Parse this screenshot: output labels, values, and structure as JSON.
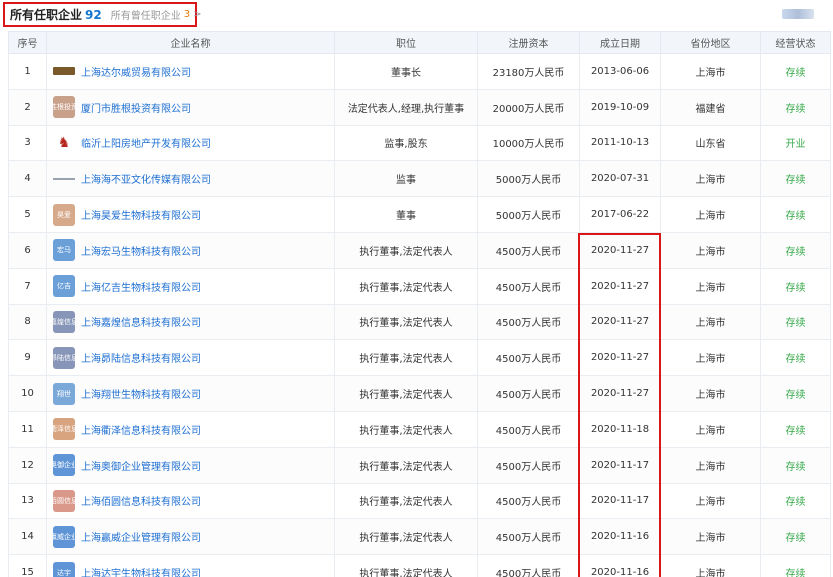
{
  "tabs": {
    "active_label": "所有任职企业",
    "active_count": "92",
    "other_label": "所有曾任职企业",
    "other_count": "3",
    "chevron": ">"
  },
  "table": {
    "headers": [
      "序号",
      "企业名称",
      "职位",
      "注册资本",
      "成立日期",
      "省份地区",
      "经营状态"
    ],
    "rows": [
      {
        "no": "1",
        "logo": "",
        "logo_style": "bar",
        "logo_color": "#7a5a2a",
        "name": "上海达尔威贸易有限公司",
        "position": "董事长",
        "capital": "23180万人民币",
        "date": "2013-06-06",
        "region": "上海市",
        "status": "存续"
      },
      {
        "no": "2",
        "logo": "胜根投资",
        "logo_style": "box",
        "logo_color": "#c9a08a",
        "name": "厦门市胜根投资有限公司",
        "position": "法定代表人,经理,执行董事",
        "capital": "20000万人民币",
        "date": "2019-10-09",
        "region": "福建省",
        "status": "存续"
      },
      {
        "no": "3",
        "logo": "♞",
        "logo_style": "emblem",
        "logo_color": "#ffffff",
        "name": "临沂上阳房地产开发有限公司",
        "position": "监事,股东",
        "capital": "10000万人民币",
        "date": "2011-10-13",
        "region": "山东省",
        "status": "开业"
      },
      {
        "no": "4",
        "logo": "",
        "logo_style": "line",
        "logo_color": "#9aa4b0",
        "name": "上海海不亚文化传媒有限公司",
        "position": "监事",
        "capital": "5000万人民币",
        "date": "2020-07-31",
        "region": "上海市",
        "status": "存续"
      },
      {
        "no": "5",
        "logo": "昊爱",
        "logo_style": "box",
        "logo_color": "#d5a98a",
        "name": "上海昊爱生物科技有限公司",
        "position": "董事",
        "capital": "5000万人民币",
        "date": "2017-06-22",
        "region": "上海市",
        "status": "存续"
      },
      {
        "no": "6",
        "logo": "宏马",
        "logo_style": "box",
        "logo_color": "#6a9fd8",
        "name": "上海宏马生物科技有限公司",
        "position": "执行董事,法定代表人",
        "capital": "4500万人民币",
        "date": "2020-11-27",
        "region": "上海市",
        "status": "存续"
      },
      {
        "no": "7",
        "logo": "亿吉",
        "logo_style": "box",
        "logo_color": "#6a9fd8",
        "name": "上海亿吉生物科技有限公司",
        "position": "执行董事,法定代表人",
        "capital": "4500万人民币",
        "date": "2020-11-27",
        "region": "上海市",
        "status": "存续"
      },
      {
        "no": "8",
        "logo": "嘉煌信息",
        "logo_style": "box",
        "logo_color": "#8796b8",
        "name": "上海嘉煌信息科技有限公司",
        "position": "执行董事,法定代表人",
        "capital": "4500万人民币",
        "date": "2020-11-27",
        "region": "上海市",
        "status": "存续"
      },
      {
        "no": "9",
        "logo": "昴陆信息",
        "logo_style": "box",
        "logo_color": "#8796b8",
        "name": "上海昴陆信息科技有限公司",
        "position": "执行董事,法定代表人",
        "capital": "4500万人民币",
        "date": "2020-11-27",
        "region": "上海市",
        "status": "存续"
      },
      {
        "no": "10",
        "logo": "翔世",
        "logo_style": "box",
        "logo_color": "#7aa8d9",
        "name": "上海翔世生物科技有限公司",
        "position": "执行董事,法定代表人",
        "capital": "4500万人民币",
        "date": "2020-11-27",
        "region": "上海市",
        "status": "存续"
      },
      {
        "no": "11",
        "logo": "衢泽信息",
        "logo_style": "box",
        "logo_color": "#d8a37f",
        "name": "上海衢泽信息科技有限公司",
        "position": "执行董事,法定代表人",
        "capital": "4500万人民币",
        "date": "2020-11-18",
        "region": "上海市",
        "status": "存续"
      },
      {
        "no": "12",
        "logo": "奥御企业",
        "logo_style": "box",
        "logo_color": "#5f95d6",
        "name": "上海奥御企业管理有限公司",
        "position": "执行董事,法定代表人",
        "capital": "4500万人民币",
        "date": "2020-11-17",
        "region": "上海市",
        "status": "存续"
      },
      {
        "no": "13",
        "logo": "佰圆信息",
        "logo_style": "box",
        "logo_color": "#d9988a",
        "name": "上海佰圆信息科技有限公司",
        "position": "执行董事,法定代表人",
        "capital": "4500万人民币",
        "date": "2020-11-17",
        "region": "上海市",
        "status": "存续"
      },
      {
        "no": "14",
        "logo": "赢威企业",
        "logo_style": "box",
        "logo_color": "#5f95d6",
        "name": "上海赢威企业管理有限公司",
        "position": "执行董事,法定代表人",
        "capital": "4500万人民币",
        "date": "2020-11-16",
        "region": "上海市",
        "status": "存续"
      },
      {
        "no": "15",
        "logo": "达宇",
        "logo_style": "box",
        "logo_color": "#5f95d6",
        "name": "上海达宇生物科技有限公司",
        "position": "执行董事,法定代表人",
        "capital": "4500万人民币",
        "date": "2020-11-16",
        "region": "上海市",
        "status": "存续"
      }
    ]
  },
  "colors": {
    "highlight_border": "#d9171b",
    "link": "#1e6fd1",
    "status_active": "#36a94a"
  }
}
